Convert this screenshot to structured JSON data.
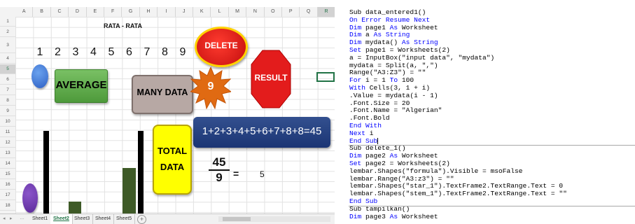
{
  "excel": {
    "columns": [
      "A",
      "B",
      "C",
      "D",
      "E",
      "F",
      "G",
      "H",
      "I",
      "J",
      "K",
      "L",
      "M",
      "N",
      "O",
      "P",
      "Q",
      "R"
    ],
    "rows": [
      "1",
      "2",
      "3",
      "4",
      "5",
      "6",
      "7",
      "8",
      "9",
      "10",
      "11",
      "12",
      "13",
      "14",
      "15",
      "16",
      "17",
      "18"
    ],
    "sheet_title": "RATA - RATA",
    "numbers": [
      "1",
      "2",
      "3",
      "4",
      "5",
      "6",
      "7",
      "8",
      "9"
    ],
    "shapes": {
      "average": "AVERAGE",
      "many_data": "MANY DATA",
      "delete": "DELETE",
      "result": "RESULT",
      "star_value": "9",
      "formula": "1+2+3+4+5+6+7+8+8=45",
      "total_line1": "TOTAL",
      "total_line2": "DATA",
      "fraction_numerator": "45",
      "fraction_denominator": "9",
      "equals": "=",
      "answer": "5"
    },
    "tabs": [
      "Sheet1",
      "Sheet2",
      "Sheet3",
      "Sheet4",
      "Sheet5"
    ],
    "active_tab": "Sheet2",
    "add_sheet_icon": "plus-circle-icon",
    "colors": {
      "average_green": "#5aa845",
      "delete_red": "#e0201a",
      "result_red": "#e31c1c",
      "star_orange": "#e06a12",
      "formula_navy": "#26427f",
      "total_yellow": "#ffff00",
      "excel_green": "#217346"
    }
  },
  "code": {
    "lines": [
      [
        {
          "t": "Sub data_entered1()",
          "k": 0
        }
      ],
      [
        {
          "t": "On Error Resume Next",
          "k": 1
        }
      ],
      [
        {
          "t": "Dim",
          "k": 1
        },
        {
          "t": " page1 ",
          "k": 0
        },
        {
          "t": "As",
          "k": 1
        },
        {
          "t": " Worksheet",
          "k": 0
        }
      ],
      [
        {
          "t": "Dim",
          "k": 1
        },
        {
          "t": " a ",
          "k": 0
        },
        {
          "t": "As",
          "k": 1
        },
        {
          "t": " ",
          "k": 0
        },
        {
          "t": "String",
          "k": 1
        }
      ],
      [
        {
          "t": "Dim",
          "k": 1
        },
        {
          "t": " mydata() ",
          "k": 0
        },
        {
          "t": "As",
          "k": 1
        },
        {
          "t": " ",
          "k": 0
        },
        {
          "t": "String",
          "k": 1
        }
      ],
      [
        {
          "t": "Set",
          "k": 1
        },
        {
          "t": " page1 = Worksheets(2)",
          "k": 0
        }
      ],
      [
        {
          "t": "a = InputBox(\"input data\", \"mydata\")",
          "k": 0
        }
      ],
      [
        {
          "t": "mydata = Split(a, \",\")",
          "k": 0
        }
      ],
      [
        {
          "t": "Range(\"A3:Z3\") = \"\"",
          "k": 0
        }
      ],
      [
        {
          "t": "For",
          "k": 1
        },
        {
          "t": " i = 1 ",
          "k": 0
        },
        {
          "t": "To",
          "k": 1
        },
        {
          "t": " 100",
          "k": 0
        }
      ],
      [
        {
          "t": "With",
          "k": 1
        },
        {
          "t": " Cells(3, 1 + i)",
          "k": 0
        }
      ],
      [
        {
          "t": ".Value = mydata(i - 1)",
          "k": 0
        }
      ],
      [
        {
          "t": ".Font.Size = 20",
          "k": 0
        }
      ],
      [
        {
          "t": ".Font.Name = \"Algerian\"",
          "k": 0
        }
      ],
      [
        {
          "t": ".Font.Bold",
          "k": 0
        }
      ],
      [
        {
          "t": "End With",
          "k": 1
        }
      ],
      [
        {
          "t": "Next",
          "k": 1
        },
        {
          "t": " i",
          "k": 0
        }
      ],
      [
        {
          "t": "End Sub",
          "k": 1
        }
      ],
      [
        {
          "t": "Sub delete_1()",
          "k": 0
        }
      ],
      [
        {
          "t": "Dim",
          "k": 1
        },
        {
          "t": " page2 ",
          "k": 0
        },
        {
          "t": "As",
          "k": 1
        },
        {
          "t": " Worksheet",
          "k": 0
        }
      ],
      [
        {
          "t": "Set",
          "k": 1
        },
        {
          "t": " page2 = Worksheets(2)",
          "k": 0
        }
      ],
      [
        {
          "t": "lembar.Shapes(\"formula\").Visible = msoFalse",
          "k": 0
        }
      ],
      [
        {
          "t": "lembar.Range(\"A3:z3\") = \"\"",
          "k": 0
        }
      ],
      [
        {
          "t": "lembar.Shapes(\"star_1\").TextFrame2.TextRange.Text = 0",
          "k": 0
        }
      ],
      [
        {
          "t": "lembar.Shapes(\"stem_1\").TextFrame2.TextRange.Text = \"\"",
          "k": 0
        }
      ],
      [
        {
          "t": "End Sub",
          "k": 1
        }
      ],
      [
        {
          "t": "Sub tampilkan()",
          "k": 0
        }
      ],
      [
        {
          "t": "Dim",
          "k": 1
        },
        {
          "t": " page3 ",
          "k": 0
        },
        {
          "t": "As",
          "k": 1
        },
        {
          "t": " Worksheet",
          "k": 0
        }
      ]
    ],
    "dividers_after": [
      17,
      25
    ]
  }
}
